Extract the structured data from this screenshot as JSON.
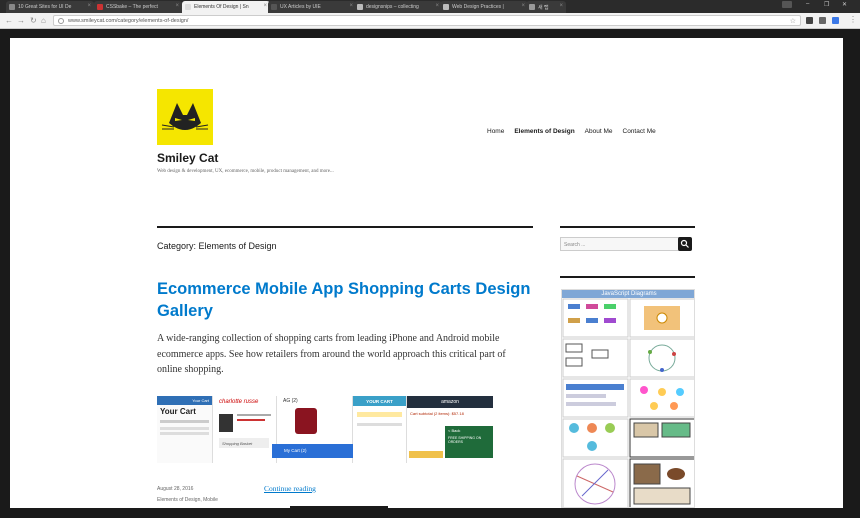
{
  "browser": {
    "tabs": [
      {
        "label": "10 Great Sites for UI De",
        "active": false
      },
      {
        "label": "CSSbake – The perfect",
        "active": false
      },
      {
        "label": "Elements Of Design | Sn",
        "active": true
      },
      {
        "label": "UX Articles by UIE",
        "active": false
      },
      {
        "label": "designsnips – collecting",
        "active": false
      },
      {
        "label": "Web Design Practices |",
        "active": false
      },
      {
        "label": "새 탭",
        "active": false
      }
    ],
    "url": "www.smileycat.com/category/elements-of-design/"
  },
  "site": {
    "title": "Smiley Cat",
    "tagline": "Web design & development, UX, ecommerce, mobile, product management, and more...",
    "logo_color": "#f5e600",
    "nav": [
      "Home",
      "Elements of Design",
      "About Me",
      "Contact Me"
    ],
    "current_nav": "Elements of Design"
  },
  "main": {
    "category_heading": "Category: Elements of Design",
    "post": {
      "title": "Ecommerce Mobile App Shopping Carts Design Gallery",
      "excerpt": "A wide-ranging collection of shopping carts from leading iPhone and Android mobile ecommerce apps. See how retailers from around the world approach this critical part of online shopping.",
      "date": "August 28, 2016",
      "categories": "Elements of Design, Mobile",
      "read_more": "Continue reading",
      "link_color": "#007acc"
    },
    "thumbnail": {
      "texts": {
        "your_cart": "Your Cart",
        "your_cart_header": "Your Cart",
        "brand1": "charlotte russe",
        "ag": "AG (2)",
        "your_cart2": "YOUR CART",
        "brand2": "amazon",
        "subtotal": "Cart subtotal (2 items): $57.18",
        "shopping_basket": "Shopping Basket",
        "my_cart": "My Cart (2)",
        "back": "< Back",
        "free_shipping": "FREE SHIPPING ON ORDERS"
      }
    }
  },
  "sidebar": {
    "search_placeholder": "Search ...",
    "ad_heading": "JavaScript Diagrams"
  }
}
